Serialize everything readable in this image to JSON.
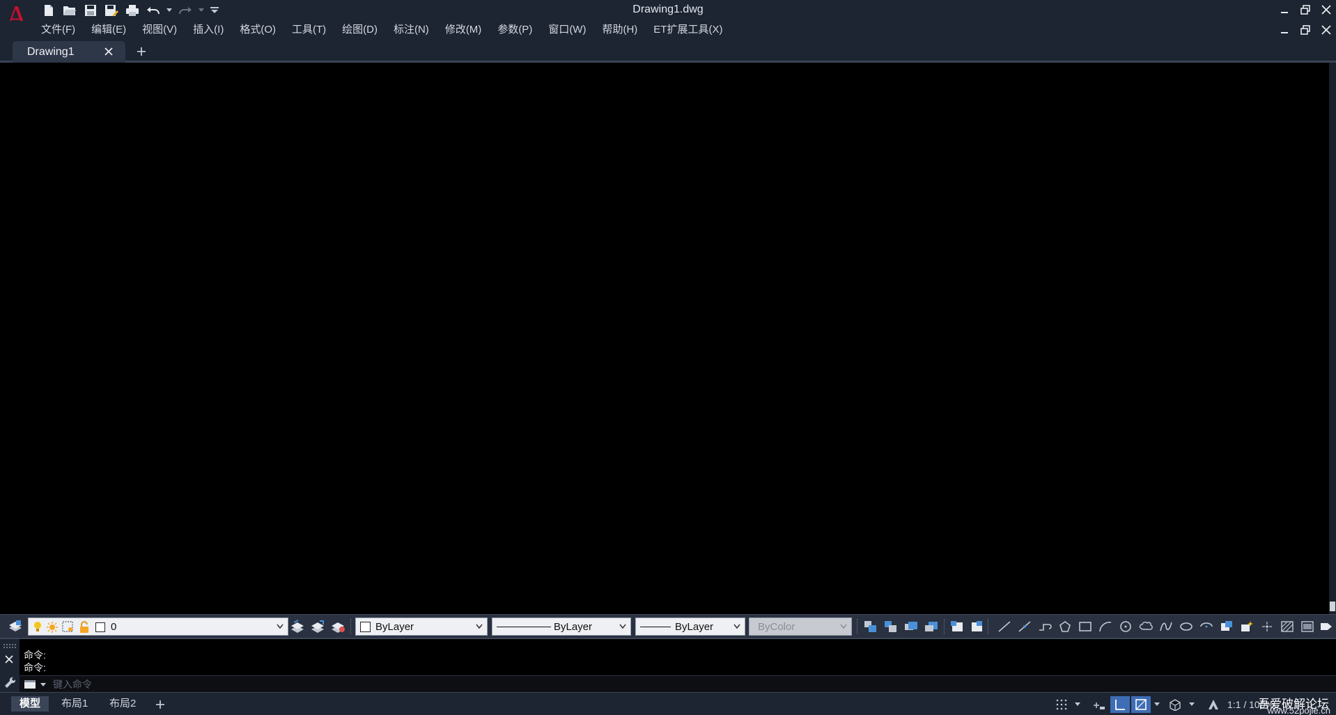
{
  "window": {
    "title": "Drawing1.dwg"
  },
  "app": {
    "logo_letter": "A",
    "brand_color": "#c8102e"
  },
  "quick_access": [
    {
      "name": "new-icon"
    },
    {
      "name": "open-icon"
    },
    {
      "name": "save-icon"
    },
    {
      "name": "save-as-icon"
    },
    {
      "name": "print-icon"
    },
    {
      "name": "undo-icon"
    },
    {
      "name": "redo-icon"
    },
    {
      "name": "customize-icon"
    }
  ],
  "menu": {
    "items": [
      "文件(F)",
      "编辑(E)",
      "视图(V)",
      "插入(I)",
      "格式(O)",
      "工具(T)",
      "绘图(D)",
      "标注(N)",
      "修改(M)",
      "参数(P)",
      "窗口(W)",
      "帮助(H)",
      "ET扩展工具(X)"
    ]
  },
  "tabs": {
    "active": "Drawing1",
    "new_tab_symbol": "+"
  },
  "toolbar": {
    "layer_value": "0",
    "color_value": "ByLayer",
    "linetype_value": "ByLayer",
    "lineweight_value": "ByLayer",
    "plotstyle_value": "ByColor"
  },
  "command": {
    "history": [
      "命令:",
      "命令:"
    ],
    "placeholder": "键入命令"
  },
  "layout_tabs": [
    "模型",
    "布局1",
    "布局2"
  ],
  "status": {
    "scale": "1:1 / 100%"
  },
  "watermark": {
    "text": "吾爱破解论坛",
    "url": "www.52pojie.cn"
  },
  "colors": {
    "chrome": "#1d2432",
    "canvas": "#000000",
    "toggle_on": "#3f6db5",
    "lightbulb": "#f5c518"
  }
}
